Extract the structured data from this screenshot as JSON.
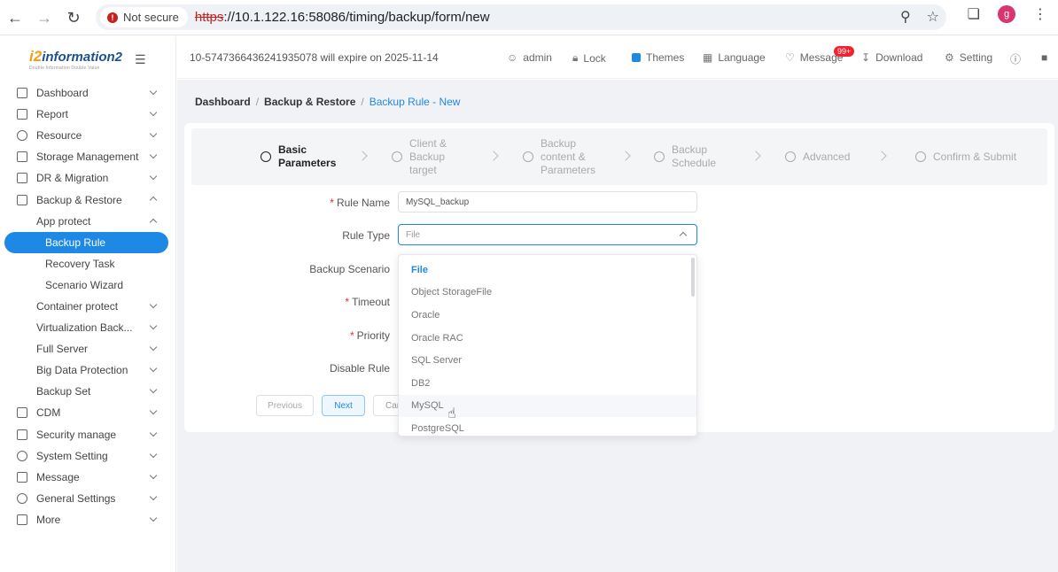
{
  "browser": {
    "not_secure": "Not secure",
    "url_scheme": "https",
    "url_rest": "://10.1.122.16:58086/timing/backup/form/new",
    "avatar_letter": "g"
  },
  "logo": {
    "main": "information2",
    "prefix": "i2",
    "tagline": "Double Information Double Value"
  },
  "sidebar": {
    "items": [
      {
        "label": "Dashboard"
      },
      {
        "label": "Report"
      },
      {
        "label": "Resource"
      },
      {
        "label": "Storage Management"
      },
      {
        "label": "DR & Migration"
      },
      {
        "label": "Backup & Restore"
      },
      {
        "label": "App protect"
      },
      {
        "label": "Backup Rule"
      },
      {
        "label": "Recovery Task"
      },
      {
        "label": "Scenario Wizard"
      },
      {
        "label": "Container protect"
      },
      {
        "label": "Virtualization Back..."
      },
      {
        "label": "Full Server"
      },
      {
        "label": "Big Data Protection"
      },
      {
        "label": "Backup Set"
      },
      {
        "label": "CDM"
      },
      {
        "label": "Security manage"
      },
      {
        "label": "System Setting"
      },
      {
        "label": "Message"
      },
      {
        "label": "General Settings"
      },
      {
        "label": "More"
      }
    ]
  },
  "topbar": {
    "license": "10-5747366436241935078 will expire on 2025-11-14",
    "admin": "admin",
    "lock": "Lock",
    "themes": "Themes",
    "language": "Language",
    "message": "Message",
    "message_badge": "99+",
    "download": "Download",
    "setting": "Setting"
  },
  "breadcrumb": {
    "a": "Dashboard",
    "b": "Backup & Restore",
    "c": "Backup Rule - New"
  },
  "steps": [
    {
      "l1": "Basic",
      "l2": "Parameters",
      "l3": ""
    },
    {
      "l1": "Client &",
      "l2": "Backup",
      "l3": "target"
    },
    {
      "l1": "Backup",
      "l2": "content &",
      "l3": "Parameters"
    },
    {
      "l1": "Backup",
      "l2": "Schedule",
      "l3": ""
    },
    {
      "l1": "Advanced",
      "l2": "",
      "l3": ""
    },
    {
      "l1": "Confirm & Submit",
      "l2": "",
      "l3": ""
    }
  ],
  "form": {
    "rule_name_label": "Rule Name",
    "rule_name_value": "MySQL_backup",
    "rule_type_label": "Rule Type",
    "rule_type_placeholder": "File",
    "backup_scenario_label": "Backup Scenario",
    "timeout_label": "Timeout",
    "priority_label": "Priority",
    "disable_rule_label": "Disable Rule",
    "required_mark": "*"
  },
  "buttons": {
    "previous": "Previous",
    "next": "Next",
    "cancel": "Car"
  },
  "dropdown": {
    "options": [
      "File",
      "Object StorageFile",
      "Oracle",
      "Oracle RAC",
      "SQL Server",
      "DB2",
      "MySQL",
      "PostgreSQL"
    ],
    "selected": "File",
    "hovered": "MySQL"
  },
  "colors": {
    "accent": "#1e88e5",
    "badge": "#f5222d"
  }
}
